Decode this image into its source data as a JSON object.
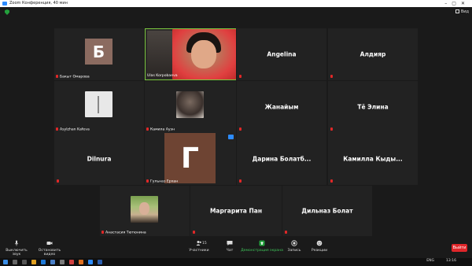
{
  "window": {
    "title": "Zoom Конференция, 40 мин",
    "view_label": "Вид"
  },
  "participants": [
    {
      "name": "Бакыт Омарова",
      "avatar_letter": "Б",
      "avatar_color": "#8b6b60"
    },
    {
      "name": "Ulas Korpobaeva",
      "active": true
    },
    {
      "name": "Angelina",
      "big": true
    },
    {
      "name": "Алдияр",
      "big": true
    },
    {
      "name": "Asylzhan Kafeva"
    },
    {
      "name": "Камила Ауэн"
    },
    {
      "name": "Жанайым",
      "big": true
    },
    {
      "name": "Тё Элина",
      "big": true
    },
    {
      "name": "Dilnura",
      "big": true
    },
    {
      "name": "Гульназ Ерхан",
      "avatar_letter": "Г",
      "avatar_color": "#6e4433"
    },
    {
      "name": "Дарина Болатб...",
      "big": true
    },
    {
      "name": "Камилла Кыды...",
      "big": true
    },
    {
      "name": "Анастасия Тютюнина"
    },
    {
      "name": "Маргарита Пан",
      "big": true
    },
    {
      "name": "Дильназ Болат",
      "big": true
    }
  ],
  "toolbar": {
    "mute": "Выключить звук",
    "video": "Остановить видео",
    "participants": "Участники",
    "participants_count": "15",
    "chat": "Чат",
    "share": "Демонстрация экрана",
    "record": "Запись",
    "reactions": "Реакции",
    "end": "Выйти"
  },
  "taskbar": {
    "lang": "ENG",
    "time": "13:16"
  },
  "colors": {
    "accent_green": "#23a03c",
    "active_border": "#7cc940",
    "end_red": "#e0262a",
    "mute_red": "#e02828"
  }
}
